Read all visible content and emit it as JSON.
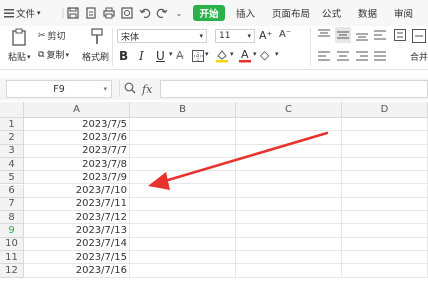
{
  "menu": {
    "file_label": "文件",
    "start_label": "开始",
    "insert_label": "插入",
    "layout_label": "页面布局",
    "formula_label": "公式",
    "data_label": "数据",
    "review_label": "审阅"
  },
  "ribbon": {
    "cut_label": "剪切",
    "copy_label": "复制",
    "paste_label": "粘贴",
    "format_painter_label": "格式刷",
    "font_name": "宋体",
    "font_size": "11",
    "merge_label": "合并"
  },
  "formula_bar": {
    "cell_ref": "F9",
    "fx_label": "fx"
  },
  "sheet": {
    "columns": [
      "A",
      "B",
      "C",
      "D"
    ],
    "rows": [
      {
        "num": "1",
        "a": "2023/7/5"
      },
      {
        "num": "2",
        "a": "2023/7/6"
      },
      {
        "num": "3",
        "a": "2023/7/7"
      },
      {
        "num": "4",
        "a": "2023/7/8"
      },
      {
        "num": "5",
        "a": "2023/7/9"
      },
      {
        "num": "6",
        "a": "2023/7/10"
      },
      {
        "num": "7",
        "a": "2023/7/11"
      },
      {
        "num": "8",
        "a": "2023/7/12"
      },
      {
        "num": "9",
        "a": "2023/7/13"
      },
      {
        "num": "10",
        "a": "2023/7/14"
      },
      {
        "num": "11",
        "a": "2023/7/15"
      },
      {
        "num": "12",
        "a": "2023/7/16"
      }
    ]
  },
  "colors": {
    "accent": "#2bb14a",
    "arrow": "#e8322e"
  }
}
